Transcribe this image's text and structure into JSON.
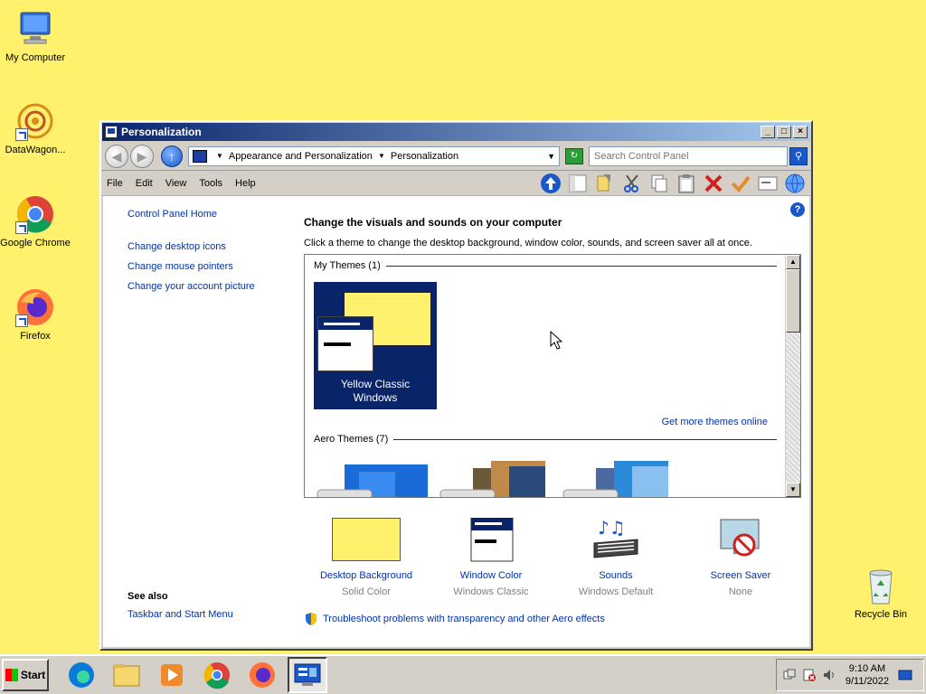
{
  "desktop": {
    "background_color": "#FFF16B",
    "icons": [
      {
        "label": "My Computer",
        "icon": "computer-icon"
      },
      {
        "label": "DataWagon...",
        "icon": "datawagon-icon"
      },
      {
        "label": "Google Chrome",
        "icon": "chrome-icon"
      },
      {
        "label": "Firefox",
        "icon": "firefox-icon"
      },
      {
        "label": "Recycle Bin",
        "icon": "recycle-bin-icon"
      }
    ]
  },
  "window": {
    "title": "Personalization",
    "title_buttons": {
      "minimize": "_",
      "maximize": "□",
      "close": "×"
    },
    "address": {
      "crumbs": [
        "Appearance and Personalization",
        "Personalization"
      ],
      "search_placeholder": "Search Control Panel"
    },
    "menu": [
      "File",
      "Edit",
      "View",
      "Tools",
      "Help"
    ],
    "left_pane": {
      "home": "Control Panel Home",
      "links": [
        "Change desktop icons",
        "Change mouse pointers",
        "Change your account picture"
      ],
      "see_also_header": "See also",
      "see_also_links": [
        "Taskbar and Start Menu"
      ]
    },
    "main": {
      "title": "Change the visuals and sounds on your computer",
      "description": "Click a theme to change the desktop background, window color, sounds, and screen saver all at once.",
      "my_themes_header": "My Themes (1)",
      "selected_theme": {
        "name_line1": "Yellow Classic",
        "name_line2": "Windows"
      },
      "get_more_link": "Get more themes online",
      "aero_header": "Aero Themes (7)"
    },
    "bottom": [
      {
        "name": "Desktop Background",
        "value": "Solid Color"
      },
      {
        "name": "Window Color",
        "value": "Windows Classic"
      },
      {
        "name": "Sounds",
        "value": "Windows Default"
      },
      {
        "name": "Screen Saver",
        "value": "None"
      }
    ],
    "troubleshoot_link": "Troubleshoot problems with transparency and other Aero effects"
  },
  "taskbar": {
    "start_label": "Start",
    "apps": [
      "edge-icon",
      "file-explorer-icon",
      "media-player-icon",
      "chrome-icon",
      "firefox-icon",
      "control-panel-icon"
    ],
    "time": "9:10 AM",
    "date": "9/11/2022"
  },
  "colors": {
    "title_bar_start": "#0A246A",
    "title_bar_end": "#A6CAF0",
    "link": "#0033a8",
    "window_face": "#D4D0C8"
  }
}
